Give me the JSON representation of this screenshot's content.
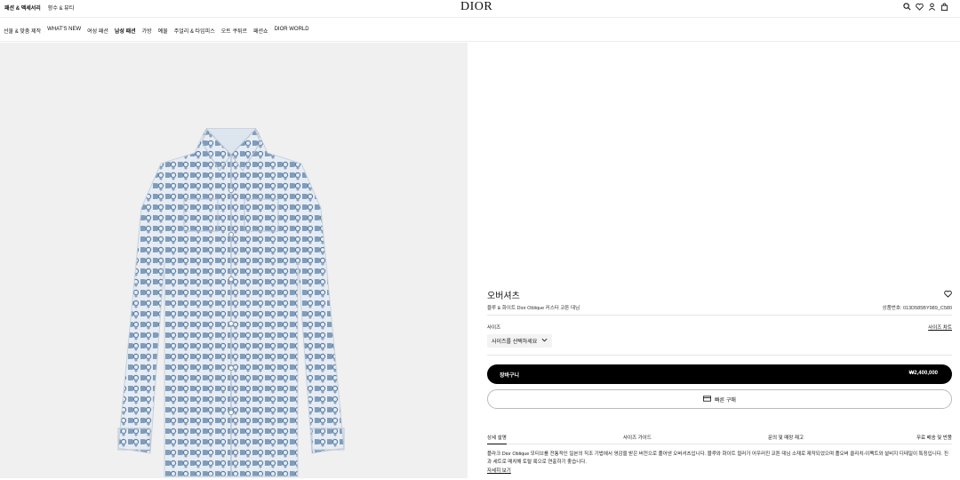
{
  "header": {
    "top_links": [
      "패션 & 액세서리",
      "향수 & 뷰티"
    ],
    "logo": "DIOR",
    "icons": [
      "search-icon",
      "heart-icon",
      "user-icon",
      "bag-icon"
    ]
  },
  "nav": {
    "items": [
      "선물 & 맞춤 제작",
      "WHAT'S NEW",
      "여성 패션",
      "남성 패션",
      "가방",
      "예물",
      "주얼리 & 타임피스",
      "오트 쿠튀르",
      "패션쇼",
      "DIOR WORLD"
    ]
  },
  "product": {
    "title": "오버셔츠",
    "subtitle": "블루 & 화이트 Dior Oblique 커스터 코튼 데님",
    "sku": "상품번호: 013D585BY989_C580",
    "size_label": "사이즈",
    "size_chart": "사이즈 차트",
    "size_placeholder": "사이즈를 선택하세요",
    "add_to_cart": "장바구니",
    "price": "₩2,400,000",
    "quick_buy": "빠른 구매"
  },
  "tabs": [
    "상세 설명",
    "사이즈 가이드",
    "문의 및 매장 재고",
    "무료 배송 및 반품"
  ],
  "description": {
    "text": "플라크 Dior Oblique 모티브를 전통적인 일본의 직조 기법에서 영감을 받은 버전으로 풀어낸 오버셔츠입니다. 블루와 화이트 컬러가 어우러진 코튼 데님 소재로 제작되었으며 폴오버 클리치-이펙트와 설비지 디테일이 특징입니다. 진과 세트로 매치해 토탈 룩으로 연출하기 좋습니다.",
    "more": "자세히 보기"
  },
  "colors": {
    "accent": "#000000",
    "image_bg": "#f0f0f0",
    "shirt_blue": "#6f8fb3"
  }
}
